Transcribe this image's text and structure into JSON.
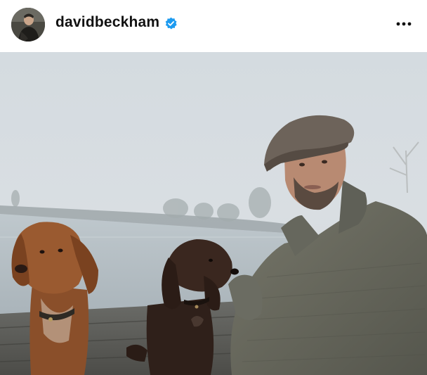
{
  "post": {
    "username": "davidbeckham",
    "verified": true,
    "avatar_icon": "profile-photo",
    "menu_icon": "more-options-icon"
  },
  "colors": {
    "accent_verified": "#1d9bf0",
    "text_primary": "#111111"
  }
}
